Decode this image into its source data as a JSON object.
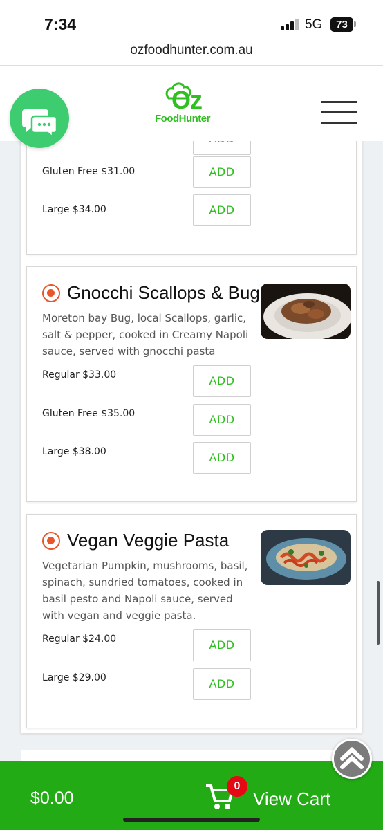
{
  "status_bar": {
    "time": "7:34",
    "network": "5G",
    "battery": "73"
  },
  "browser": {
    "url": "ozfoodhunter.com.au"
  },
  "header": {
    "logo_main": "Oz",
    "logo_sub": "FoodHunter",
    "chat_icon": "chat-bubbles-icon",
    "menu_icon": "hamburger-menu-icon"
  },
  "menu": {
    "partial_item": {
      "options": [
        {
          "label": "Gluten Free $31.00",
          "button": "ADD"
        },
        {
          "label": "Large $34.00",
          "button": "ADD"
        }
      ]
    },
    "items": [
      {
        "title": "Gnocchi Scallops & Bug",
        "description": "Moreton bay Bug, local Scallops, garlic, salt & pepper, cooked in Creamy Napoli sauce, served with gnocchi pasta",
        "options": [
          {
            "label": "Regular $33.00",
            "button": "ADD"
          },
          {
            "label": "Gluten Free $35.00",
            "button": "ADD"
          },
          {
            "label": "Large $38.00",
            "button": "ADD"
          }
        ]
      },
      {
        "title": "Vegan Veggie Pasta",
        "description": "Vegetarian Pumpkin, mushrooms, basil, spinach, sundried tomatoes, cooked in basil pesto and Napoli sauce, served with vegan and veggie pasta.",
        "options": [
          {
            "label": "Regular $24.00",
            "button": "ADD"
          },
          {
            "label": "Large $29.00",
            "button": "ADD"
          }
        ]
      }
    ]
  },
  "cart": {
    "total": "$0.00",
    "count": "0",
    "view_label": "View Cart"
  },
  "colors": {
    "brand_green": "#23ab16",
    "accent_orange": "#e8562a",
    "chat_green": "#3ecc71"
  }
}
